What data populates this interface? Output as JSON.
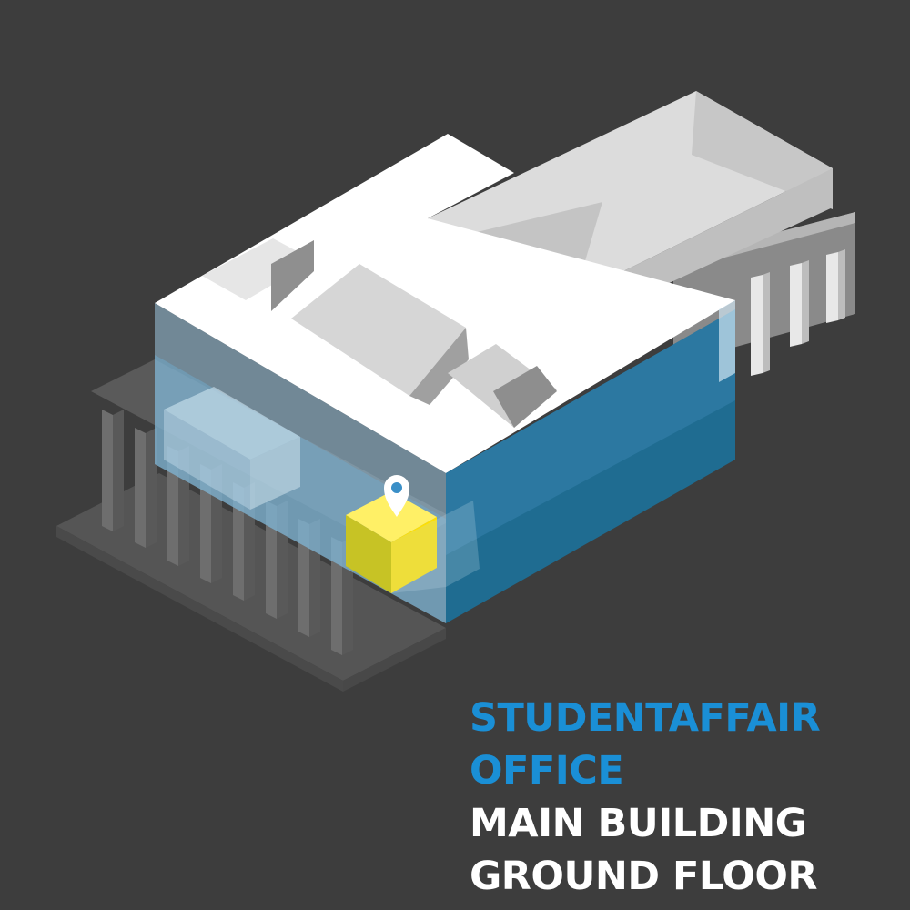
{
  "caption": {
    "destination_line1": "STUDENTAFFAIR",
    "destination_line2": "OFFICE",
    "building_line": "MAIN BUILDING",
    "floor_line": "GROUND FLOOR"
  },
  "colors": {
    "background": "#3d3d3d",
    "destination_text": "#1a8fd6",
    "location_text": "#ffffff",
    "highlight_room": "#ffe000",
    "current_floor": "#2e7aa3",
    "roof": "#ffffff"
  },
  "icons": {
    "location_marker": "map-pin-icon"
  }
}
